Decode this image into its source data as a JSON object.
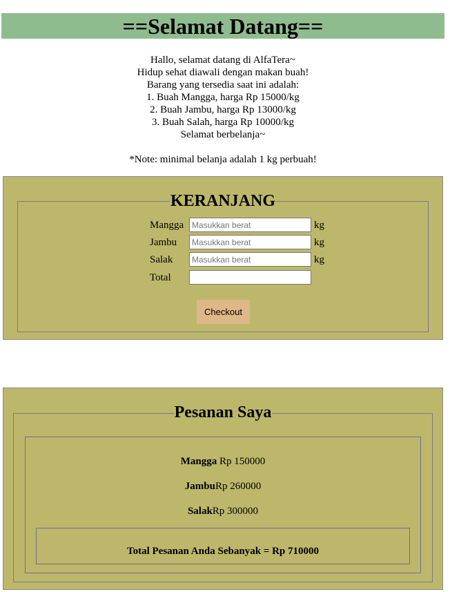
{
  "header": {
    "title": "==Selamat Datang=="
  },
  "intro": {
    "lines": [
      "Hallo, selamat datang di AlfaTera~",
      "Hidup sehat diawali dengan makan buah!",
      "Barang yang tersedia saat ini adalah:",
      "1. Buah Mangga, harga Rp 15000/kg",
      "2. Buah Jambu, harga Rp 13000/kg",
      "3. Buah Salah, harga Rp 10000/kg",
      "Selamat berbelanja~"
    ],
    "note": "*Note: minimal belanja adalah 1 kg perbuah!"
  },
  "cart": {
    "title": "KERANJANG",
    "rows": [
      {
        "label": "Mangga",
        "placeholder": "Masukkan berat",
        "unit": "kg"
      },
      {
        "label": "Jambu",
        "placeholder": "Masukkan berat",
        "unit": "kg"
      },
      {
        "label": "Salak",
        "placeholder": "Masukkan berat",
        "unit": "kg"
      }
    ],
    "total": {
      "label": "Total",
      "value": ""
    },
    "checkout_label": "Checkout"
  },
  "orders": {
    "title": "Pesanan Saya",
    "items": [
      {
        "name": "Mangga",
        "separator": " ",
        "price": "Rp 150000"
      },
      {
        "name": "Jambu",
        "separator": "",
        "price": "Rp 260000"
      },
      {
        "name": "Salak",
        "separator": "",
        "price": "Rp 300000"
      }
    ],
    "total_text": "Total Pesanan Anda Sebanyak = Rp 710000"
  },
  "colors": {
    "header_bg": "#8fbc8f",
    "panel_bg": "#bdb76b",
    "button_bg": "#deb887"
  }
}
